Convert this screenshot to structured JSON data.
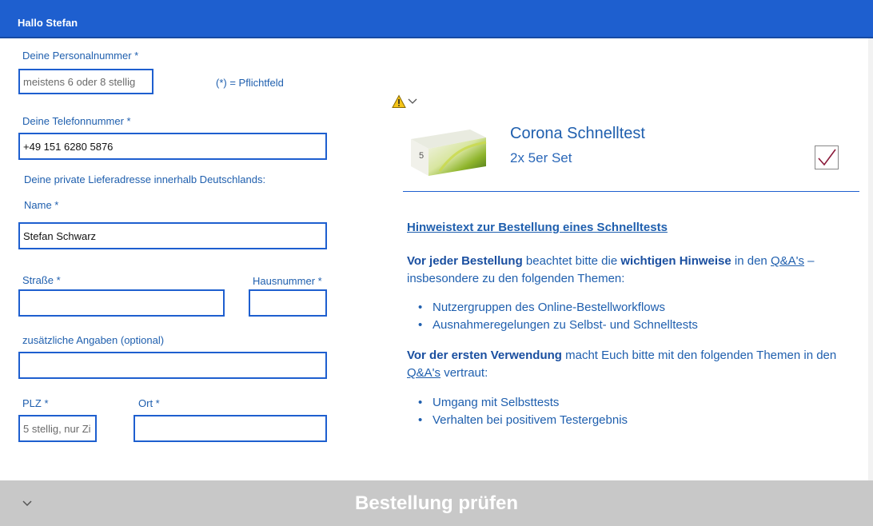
{
  "header": {
    "title": "Hallo Stefan"
  },
  "form": {
    "personalnummer": {
      "label": "Deine Personalnummer *",
      "placeholder": "meistens 6 oder 8 stellig"
    },
    "pflicht_hint": "(*) = Pflichtfeld",
    "telefon": {
      "label": "Deine Telefonnummer *",
      "value": "+49 151 6280 5876"
    },
    "lieferadresse_heading": "Deine private Lieferadresse innerhalb Deutschlands:",
    "name": {
      "label": "Name *",
      "value": "Stefan Schwarz"
    },
    "strasse": {
      "label": "Straße *",
      "value": ""
    },
    "hausnummer": {
      "label": "Hausnummer *",
      "value": ""
    },
    "zusatz": {
      "label": "zusätzliche Angaben (optional)",
      "value": ""
    },
    "plz": {
      "label": "PLZ *",
      "placeholder": "5 stellig, nur Zi"
    },
    "ort": {
      "label": "Ort *",
      "value": ""
    }
  },
  "product": {
    "title": "Corona Schnelltest",
    "subtitle": "2x 5er Set",
    "box_number": "5",
    "checked": true
  },
  "info": {
    "heading_link": "Hinweistext zur Bestellung eines Schnelltests",
    "p1": {
      "bold1": "Vor jeder Bestellung",
      "text1": " beachtet bitte die ",
      "bold2": "wichtigen Hinweise",
      "text2": " in den ",
      "link": "Q&A's",
      "text3": " – insbesondere zu den folgenden Themen:"
    },
    "list1": [
      "Nutzergruppen des Online-Bestellworkflows",
      "Ausnahmeregelungen zu Selbst- und Schnelltests"
    ],
    "p2": {
      "bold1": "Vor der ersten Verwendung",
      "text1": " macht Euch bitte mit den folgenden Themen in den ",
      "link": "Q&A's",
      "text2": " vertraut:"
    },
    "list2": [
      "Umgang mit Selbsttests",
      "Verhalten bei positivem Testergebnis"
    ]
  },
  "footer": {
    "submit_label": "Bestellung prüfen"
  },
  "colors": {
    "primary": "#1e5fcf",
    "text": "#1f5fae",
    "footer_bg": "#c8c8c8"
  },
  "icons": {
    "warning": "warning-icon",
    "expand": "chevron-down-icon",
    "check": "checkmark-icon"
  }
}
